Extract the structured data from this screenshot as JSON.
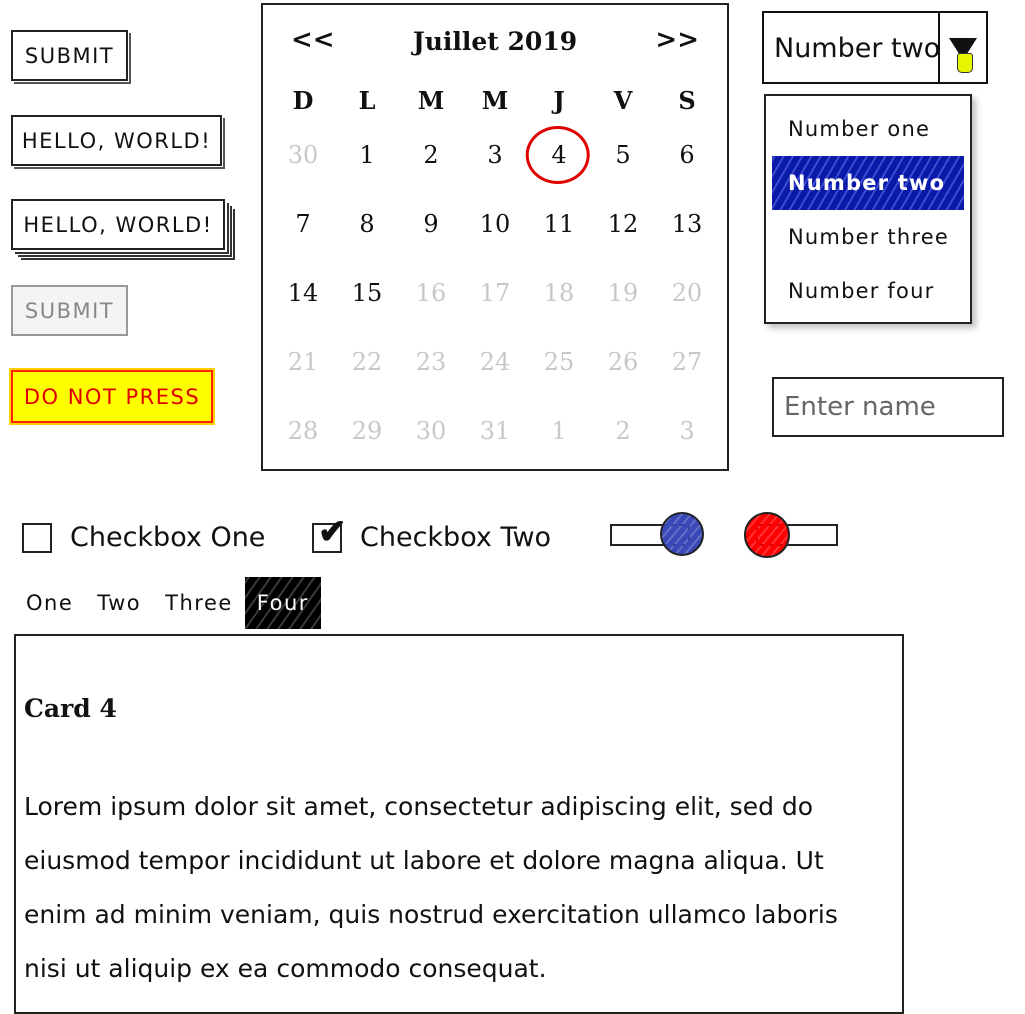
{
  "buttons": {
    "submit1": "SUBMIT",
    "hello1": "HELLO, WORLD!",
    "hello2": "HELLO, WORLD!",
    "submit_disabled": "SUBMIT",
    "danger": "DO NOT PRESS"
  },
  "calendar": {
    "title": "Juillet 2019",
    "prev": "<<",
    "next": ">>",
    "days_of_week": [
      "D",
      "L",
      "M",
      "M",
      "J",
      "V",
      "S"
    ],
    "weeks": [
      [
        {
          "d": "30",
          "muted": true
        },
        {
          "d": "1"
        },
        {
          "d": "2"
        },
        {
          "d": "3"
        },
        {
          "d": "4",
          "today": true
        },
        {
          "d": "5"
        },
        {
          "d": "6"
        }
      ],
      [
        {
          "d": "7"
        },
        {
          "d": "8"
        },
        {
          "d": "9"
        },
        {
          "d": "10"
        },
        {
          "d": "11"
        },
        {
          "d": "12"
        },
        {
          "d": "13"
        }
      ],
      [
        {
          "d": "14"
        },
        {
          "d": "15"
        },
        {
          "d": "16",
          "muted": true
        },
        {
          "d": "17",
          "muted": true
        },
        {
          "d": "18",
          "muted": true
        },
        {
          "d": "19",
          "muted": true
        },
        {
          "d": "20",
          "muted": true
        }
      ],
      [
        {
          "d": "21",
          "muted": true
        },
        {
          "d": "22",
          "muted": true
        },
        {
          "d": "23",
          "muted": true
        },
        {
          "d": "24",
          "muted": true
        },
        {
          "d": "25",
          "muted": true
        },
        {
          "d": "26",
          "muted": true
        },
        {
          "d": "27",
          "muted": true
        }
      ],
      [
        {
          "d": "28",
          "muted": true
        },
        {
          "d": "29",
          "muted": true
        },
        {
          "d": "30",
          "muted": true
        },
        {
          "d": "31",
          "muted": true
        },
        {
          "d": "1",
          "muted": true
        },
        {
          "d": "2",
          "muted": true
        },
        {
          "d": "3",
          "muted": true
        }
      ]
    ]
  },
  "select": {
    "value": "Number two",
    "options": [
      "Number one",
      "Number two",
      "Number three",
      "Number four"
    ],
    "selected_index": 1
  },
  "name_input": {
    "placeholder": "Enter name",
    "value": ""
  },
  "checkboxes": [
    {
      "label": "Checkbox One",
      "checked": false
    },
    {
      "label": "Checkbox Two",
      "checked": true
    }
  ],
  "toggles": [
    {
      "state": "on",
      "knob_color": "#3a49b8"
    },
    {
      "state": "off",
      "knob_color": "#ff0000"
    }
  ],
  "tabs": [
    "One",
    "Two",
    "Three",
    "Four"
  ],
  "active_tab": 3,
  "card": {
    "title": "Card 4",
    "text": "Lorem ipsum dolor sit amet, consectetur adipiscing elit, sed do eiusmod tempor incididunt ut labore et dolore magna aliqua. Ut enim ad minim veniam, quis nostrud exercitation ullamco laboris nisi ut aliquip ex ea commodo consequat."
  }
}
